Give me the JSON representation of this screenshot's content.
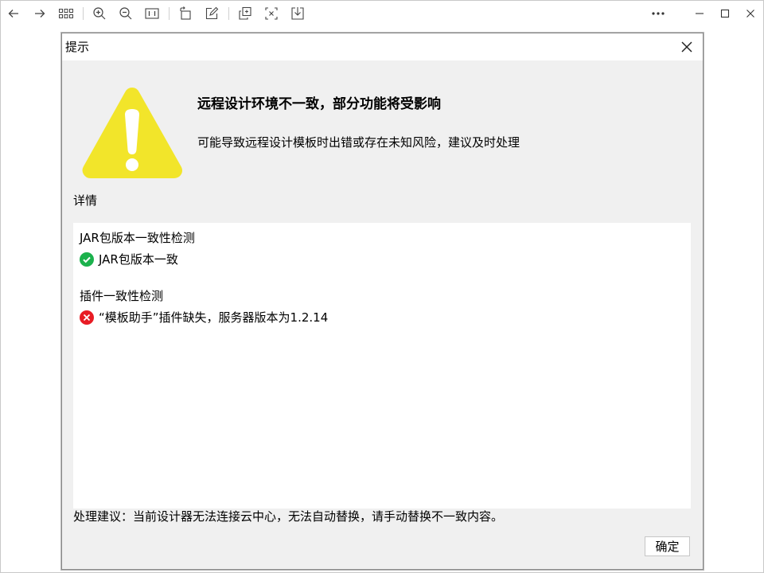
{
  "toolbar": {
    "icons": [
      "back-icon",
      "forward-icon",
      "grid-icon",
      "zoom-in-icon",
      "zoom-out-icon",
      "actual-size-icon",
      "rotate-icon",
      "edit-icon",
      "copy-icon",
      "crop-icon",
      "download-icon",
      "more-icon",
      "minimize-icon",
      "maximize-icon",
      "close-icon"
    ]
  },
  "dialog": {
    "title": "提示",
    "headline": "远程设计环境不一致，部分功能将受影响",
    "subline": "可能导致远程设计模板时出错或存在未知风险，建议及时处理",
    "details_label": "详情",
    "checks": [
      {
        "title": "JAR包版本一致性检测",
        "status": "pass",
        "result": "JAR包版本一致"
      },
      {
        "title": "插件一致性检测",
        "status": "fail",
        "result": "“模板助手”插件缺失，服务器版本为1.2.14"
      }
    ],
    "advice": "处理建议：当前设计器无法连接云中心，无法自动替换，请手动替换不一致内容。",
    "ok_label": "确定",
    "colors": {
      "warning": "#f2e52a",
      "pass": "#1bb14c",
      "fail": "#e81c24"
    }
  }
}
